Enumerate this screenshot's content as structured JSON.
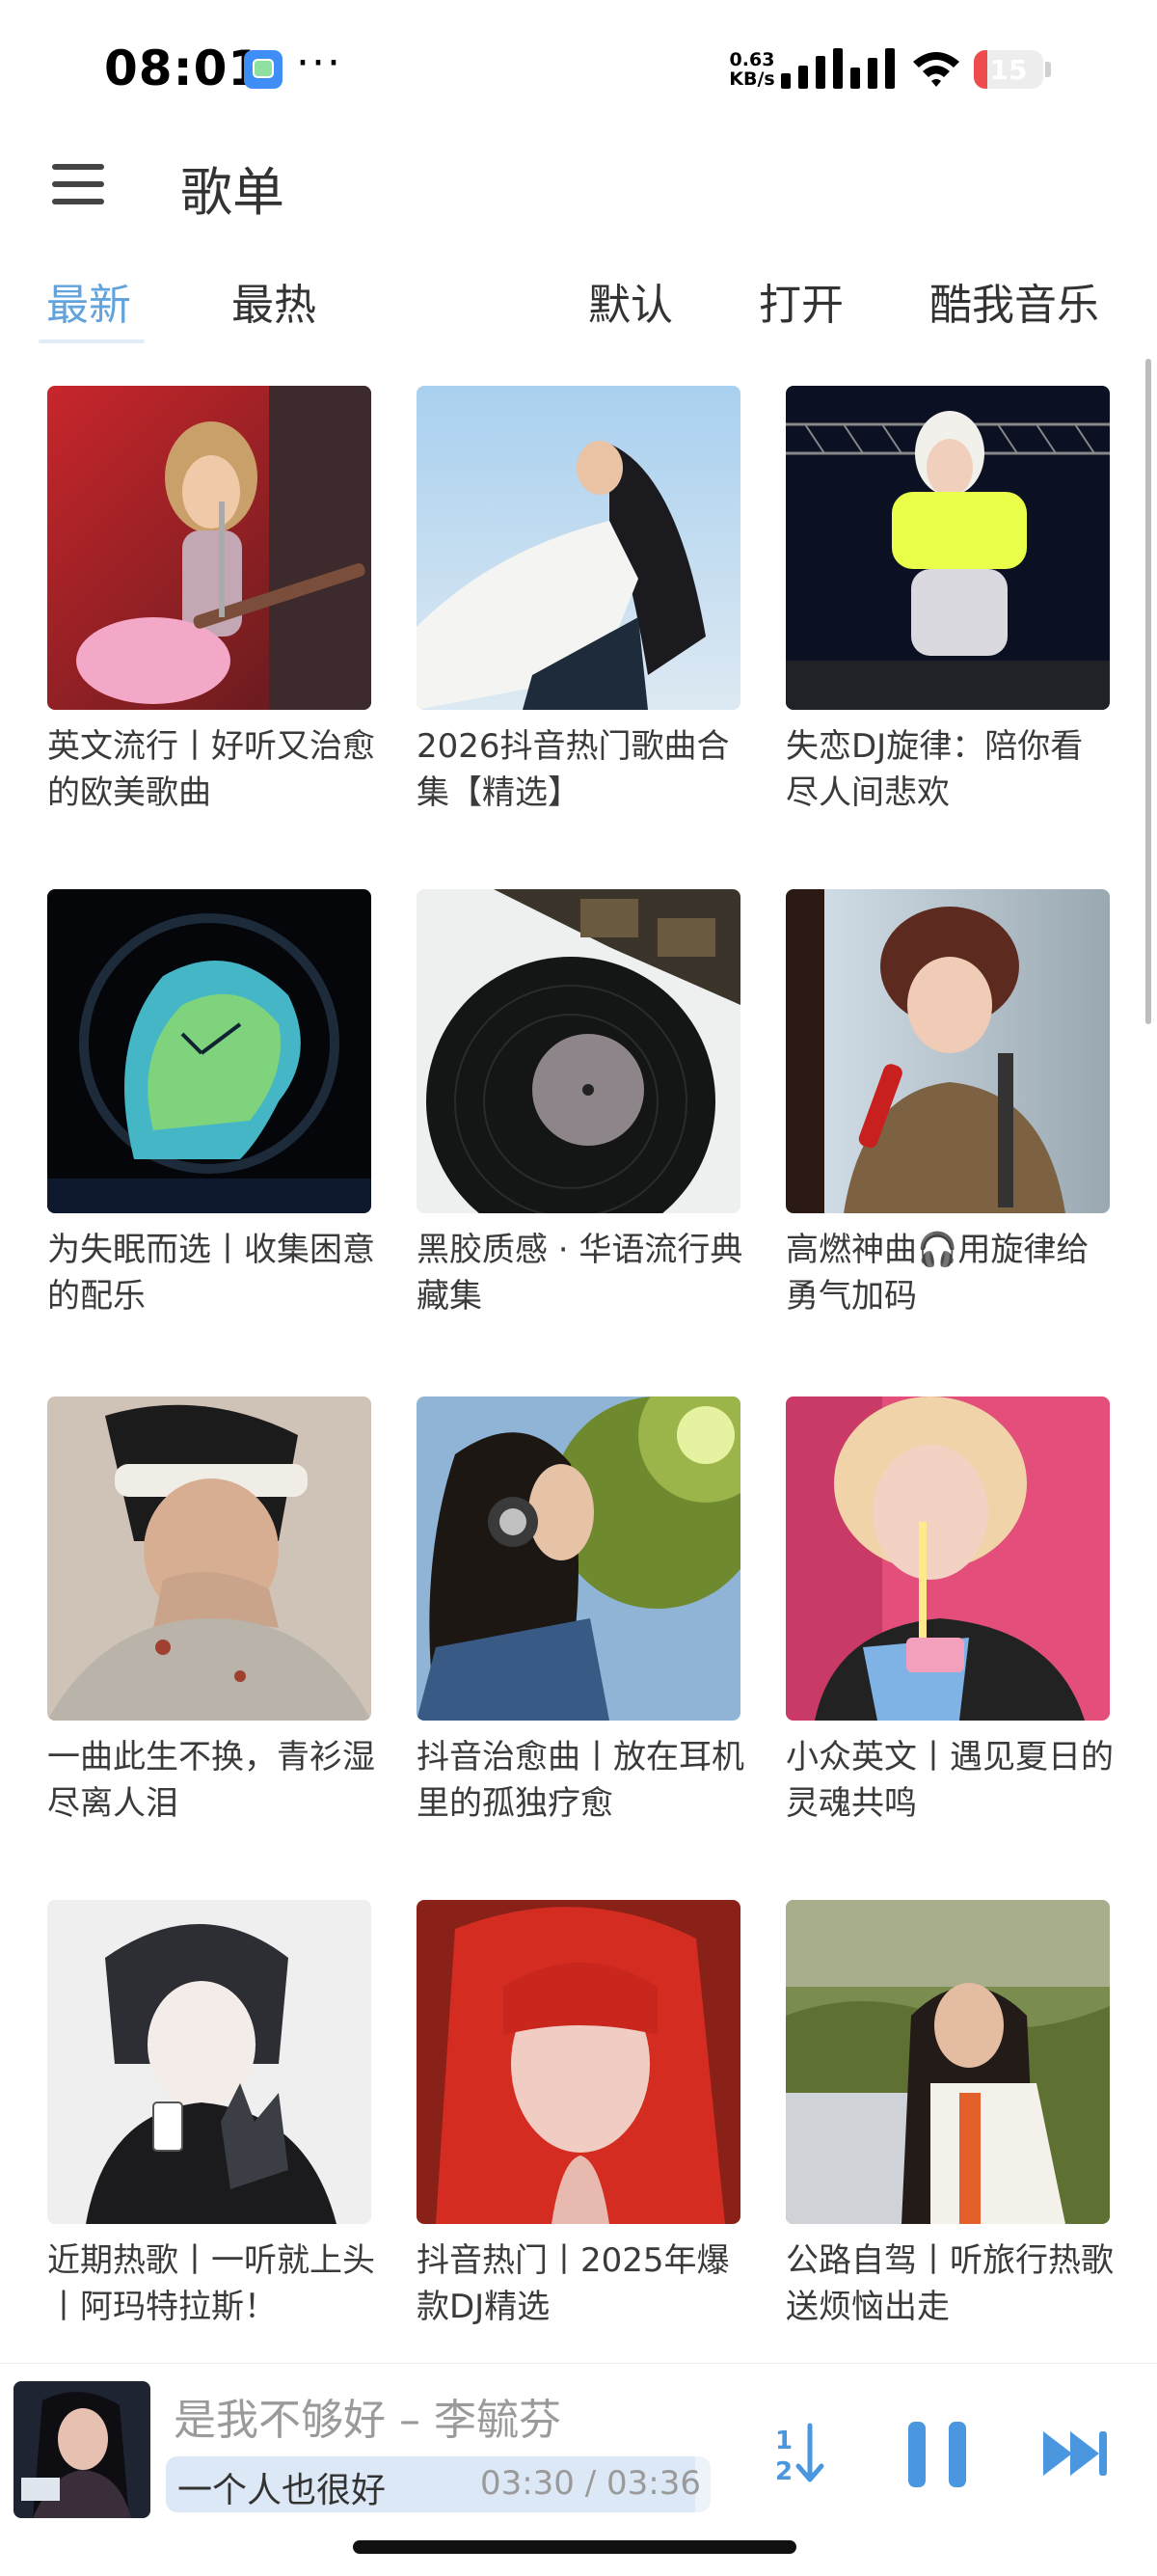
{
  "status_bar": {
    "time": "08:01",
    "overflow": "···",
    "net_speed_value": "0.63",
    "net_speed_unit": "KB/s",
    "battery_level": "15",
    "battery_color": "#ee4c4c",
    "battery_fraction": 0.2
  },
  "app_bar": {
    "menu_icon": "hamburger-menu-icon",
    "title": "歌单"
  },
  "tabs": [
    {
      "label": "最新",
      "active": true
    },
    {
      "label": "最热",
      "active": false
    },
    {
      "label": "默认",
      "active": false
    },
    {
      "label": "打开",
      "active": false
    },
    {
      "label": "酷我音乐",
      "active": false
    }
  ],
  "accent_color": "#62a3dc",
  "playlists": [
    {
      "title": "英文流行丨好听又治愈的欧美歌曲"
    },
    {
      "title": "2026抖音热门歌曲合集【精选】"
    },
    {
      "title": "失恋DJ旋律：陪你看尽人间悲欢"
    },
    {
      "title": "为失眠而选丨收集困意的配乐"
    },
    {
      "title": "黑胶质感 · 华语流行典藏集"
    },
    {
      "title": "高燃神曲🎧用旋律给勇气加码"
    },
    {
      "title": "一曲此生不换，青衫湿尽离人泪"
    },
    {
      "title": "抖音治愈曲丨放在耳机里的孤独疗愈"
    },
    {
      "title": "小众英文丨遇见夏日的灵魂共鸣"
    },
    {
      "title": "近期热歌丨一听就上头丨阿玛特拉斯！"
    },
    {
      "title": "抖音热门丨2025年爆款DJ精选"
    },
    {
      "title": "公路自驾丨听旅行热歌送烦恼出走"
    }
  ],
  "player": {
    "song": "是我不够好 – 李毓芬",
    "lyric": "一个人也很好",
    "time": "03:30 / 03:36",
    "progress": 0.972,
    "icons": [
      "sort-order-icon",
      "pause-icon",
      "skip-next-icon"
    ]
  }
}
